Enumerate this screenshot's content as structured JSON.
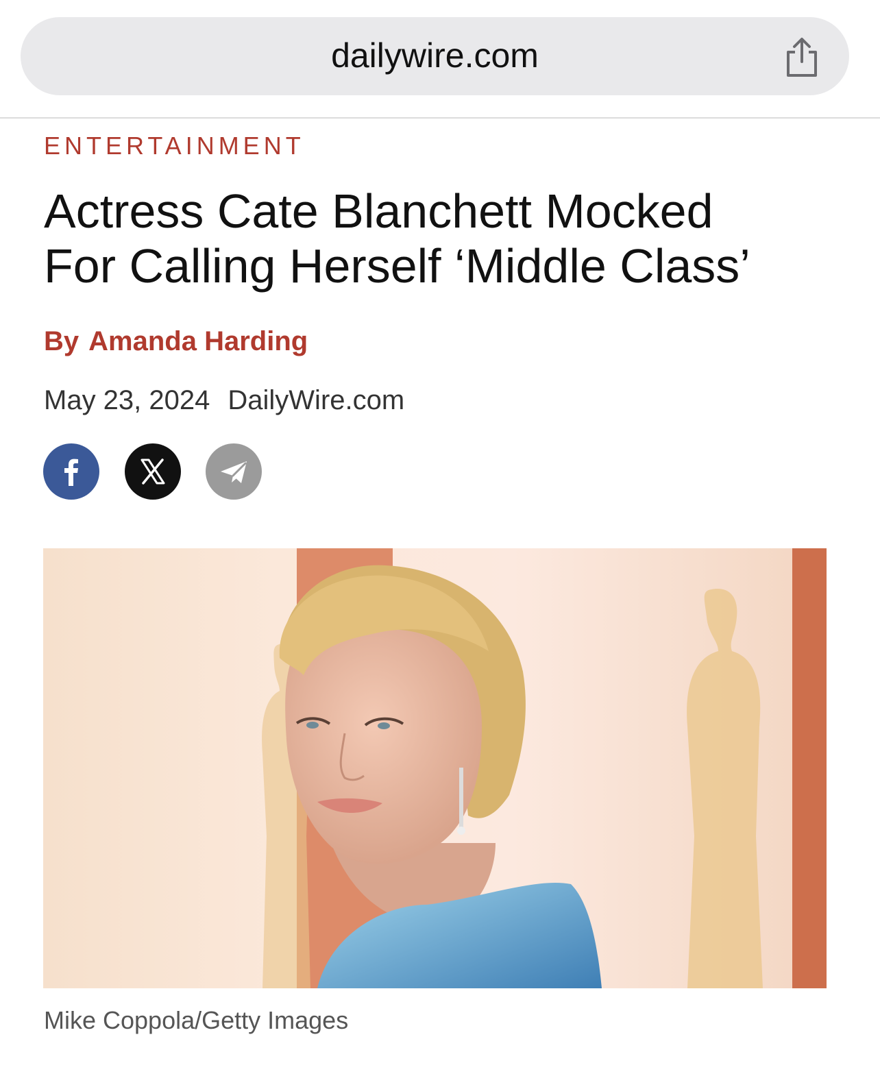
{
  "browser": {
    "url": "dailywire.com",
    "share_icon": "share-icon"
  },
  "article": {
    "category": "ENTERTAINMENT",
    "headline_line1": "Actress Cate Blanchett Mocked",
    "headline_line2": "For Calling Herself ‘Middle Class’",
    "byline_prefix": "By",
    "author": "Amanda Harding",
    "date": "May 23, 2024",
    "source": "DailyWire.com",
    "photo_credit": "Mike Coppola/Getty Images"
  },
  "share_buttons": [
    {
      "name": "facebook",
      "icon": "facebook-icon",
      "color": "#3b5998"
    },
    {
      "name": "x",
      "icon": "x-icon",
      "color": "#111111"
    },
    {
      "name": "telegram",
      "icon": "telegram-icon",
      "color": "#9b9b9b"
    }
  ],
  "colors": {
    "accent": "#b03a2e",
    "urlbar_bg": "#e9e9eb"
  }
}
